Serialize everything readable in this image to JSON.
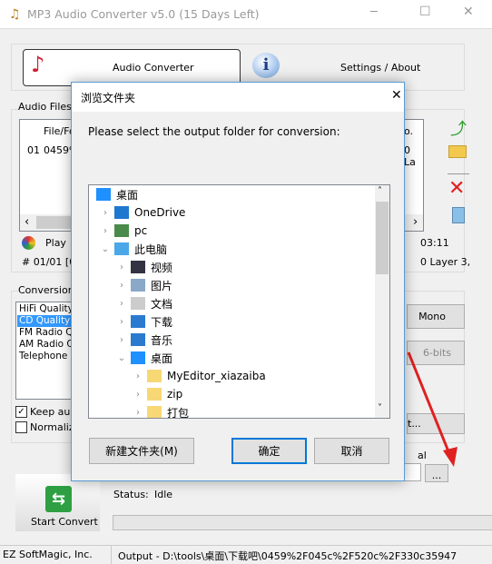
{
  "window": {
    "title": "MP3 Audio Converter v5.0 (15 Days Left)",
    "minimize": "─",
    "maximize": "☐",
    "close": "✕"
  },
  "tabs": [
    {
      "label": "Audio Converter"
    },
    {
      "label": "Settings / About"
    }
  ],
  "audio_files": {
    "group_label": "Audio Files/F",
    "column_file": "File/Fo",
    "column_right": "o.",
    "row_num": "01",
    "row_file": "0459%",
    "row_right": "0 La",
    "scroll_left": "‹",
    "scroll_right": "›"
  },
  "player": {
    "play_label": "Play",
    "time": "03:11",
    "track_info": "# 01/01 [04",
    "format_info": "0 Layer 3,"
  },
  "conversion": {
    "group_label": "Conversion (",
    "qualities": [
      "HiFi Quality",
      "CD Quality",
      "FM Radio Qu",
      "AM Radio Q",
      "Telephone Q"
    ],
    "selected": "CD Quality",
    "mono_label": "Mono",
    "bits_label": "6-bits",
    "edit_label": "t...",
    "keep_label": "Keep aud",
    "keep_checked": true,
    "normalize_label": "Normalize",
    "normalize_checked": false
  },
  "output": {
    "label": "al",
    "browse_label": "...",
    "status_label": "Status:",
    "status_value": "Idle",
    "progress": 0
  },
  "start_button": {
    "label": "Start Convert"
  },
  "statusbar": {
    "company": "EZ SoftMagic, Inc.",
    "output_path": "Output - D:\\tools\\桌面\\下载吧\\0459%2F045c%2F520c%2F330c35947"
  },
  "dialog": {
    "title": "浏览文件夹",
    "close": "✕",
    "prompt": "Please select the output folder for conversion:",
    "tree": [
      {
        "label": "桌面",
        "level": 0,
        "expander": "",
        "icon": "desktop-icon"
      },
      {
        "label": "OneDrive",
        "level": 1,
        "expander": "›",
        "icon": "cloud-icon"
      },
      {
        "label": "pc",
        "level": 1,
        "expander": "›",
        "icon": "user-icon"
      },
      {
        "label": "此电脑",
        "level": 1,
        "expander": "⌄",
        "icon": "computer-icon"
      },
      {
        "label": "视频",
        "level": 2,
        "expander": "›",
        "icon": "video-icon"
      },
      {
        "label": "图片",
        "level": 2,
        "expander": "›",
        "icon": "pictures-icon"
      },
      {
        "label": "文档",
        "level": 2,
        "expander": "›",
        "icon": "documents-icon"
      },
      {
        "label": "下载",
        "level": 2,
        "expander": "›",
        "icon": "download-icon"
      },
      {
        "label": "音乐",
        "level": 2,
        "expander": "›",
        "icon": "music-icon"
      },
      {
        "label": "桌面",
        "level": 2,
        "expander": "⌄",
        "icon": "desktop-icon"
      },
      {
        "label": "MyEditor_xiazaiba",
        "level": 3,
        "expander": "›",
        "icon": "folder-icon"
      },
      {
        "label": "zip",
        "level": 3,
        "expander": "›",
        "icon": "folder-icon"
      },
      {
        "label": "打包",
        "level": 3,
        "expander": "›",
        "icon": "folder-icon"
      }
    ],
    "new_folder": "新建文件夹(M)",
    "ok": "确定",
    "cancel": "取消"
  },
  "colors": {
    "accent": "#0078d7",
    "selection": "#3399ff",
    "arrow": "#e02020"
  }
}
